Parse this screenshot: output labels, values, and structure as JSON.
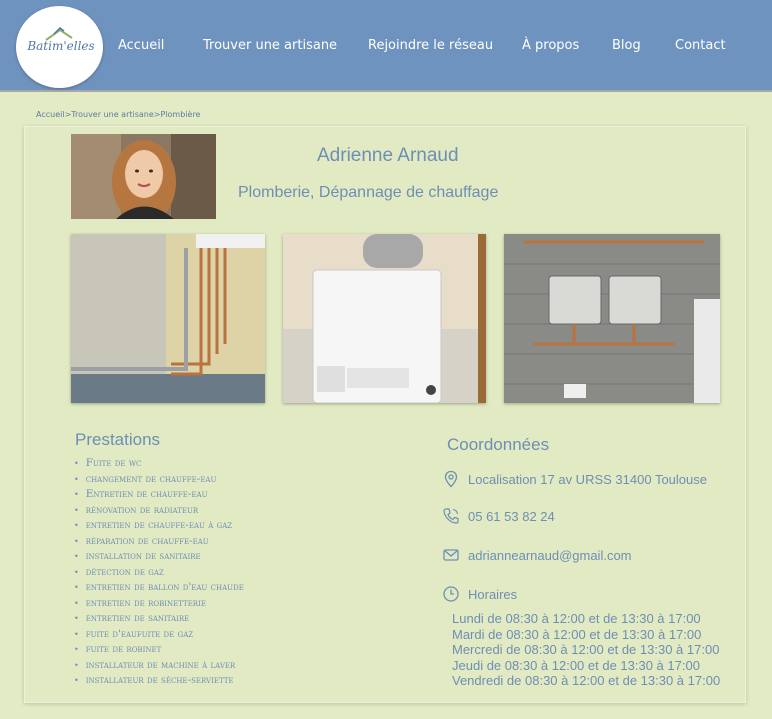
{
  "logo": {
    "text": "Batim'elles"
  },
  "nav": {
    "items": [
      "Accueil",
      "Trouver une artisane",
      "Rejoindre le réseau",
      "À propos",
      "Blog",
      "Contact"
    ]
  },
  "breadcrumb": {
    "home": "Accueil",
    "sep": ">",
    "find": "Trouver une artisane",
    "current": "Plombière"
  },
  "profile": {
    "name": "Adrienne Arnaud",
    "profession": "Plomberie, Dépannage de chauffage"
  },
  "gallery": {
    "photos": [
      "copper-pipes-photo",
      "boiler-photo",
      "wall-equipment-photo"
    ]
  },
  "prestations": {
    "title": "Prestations",
    "items": [
      "Fuite de wc",
      "changement de chauffe-eau",
      "Entretien de chauffe-eau",
      "rénovation de radiateur",
      "entretien de chauffe-eau à gaz",
      "réparation de chauffe-eau",
      "installation de sanitaire",
      "détection de gaz",
      "entretien de ballon d'eau chaude",
      "entretien de robinetterie",
      "entretien de sanitaire",
      "fuite d'eaufuite de gaz",
      "fuite de robinet",
      "installateur de machine à laver",
      "installateur de sèche-serviette"
    ]
  },
  "coordonnees": {
    "title": "Coordonnées",
    "location": "Localisation 17 av URSS 31400 Toulouse",
    "phone": "05 61 53 82 24",
    "email": "adriannearnaud@gmail.com",
    "hours_label": "Horaires",
    "hours": [
      "Lundi de 08:30 à 12:00 et de 13:30 à 17:00",
      "Mardi de 08:30 à 12:00 et de 13:30 à 17:00",
      "Mercredi de 08:30 à 12:00 et de 13:30 à 17:00",
      "Jeudi de 08:30 à 12:00 et de 13:30 à 17:00",
      "Vendredi de 08:30 à 12:00 et de 13:30 à 17:00"
    ]
  },
  "colors": {
    "header": "#6f93bf",
    "background": "#e3ebc4",
    "accent_text": "#6e8fb5"
  },
  "icons": [
    "location-icon",
    "phone-icon",
    "mail-icon",
    "clock-icon"
  ]
}
